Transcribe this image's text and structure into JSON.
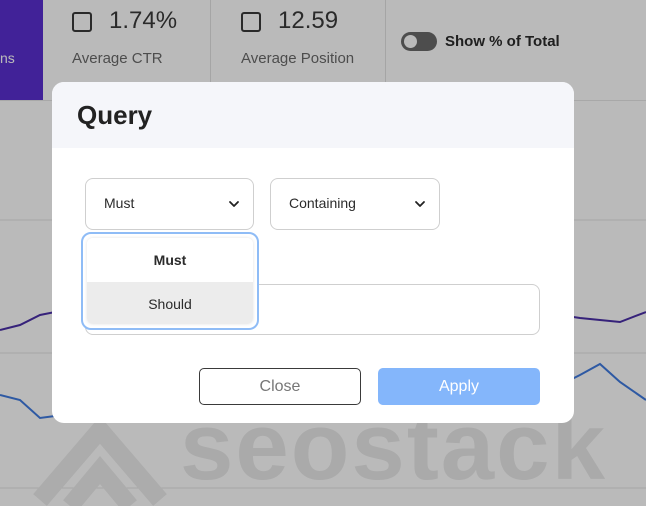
{
  "background": {
    "left_tab_text": "ns",
    "metrics": [
      {
        "value": "1.74%",
        "label": "Average CTR"
      },
      {
        "value": "12.59",
        "label": "Average Position"
      }
    ],
    "toggle_label": "Show % of Total",
    "watermark": "seostack",
    "colors": {
      "tab": "#5a2fd1",
      "line_dark": "#4a2fa8",
      "line_blue": "#3f7be0"
    }
  },
  "modal": {
    "title": "Query",
    "selects": [
      {
        "value": "Must",
        "icon": "chevron-down-icon"
      },
      {
        "value": "Containing",
        "icon": "chevron-down-icon"
      }
    ],
    "dropdown_options": [
      "Must",
      "Should"
    ],
    "text_input_value": "",
    "buttons": {
      "close": "Close",
      "apply": "Apply"
    },
    "colors": {
      "apply": "#84b6fb",
      "focus_border": "#8fbcf6"
    }
  }
}
